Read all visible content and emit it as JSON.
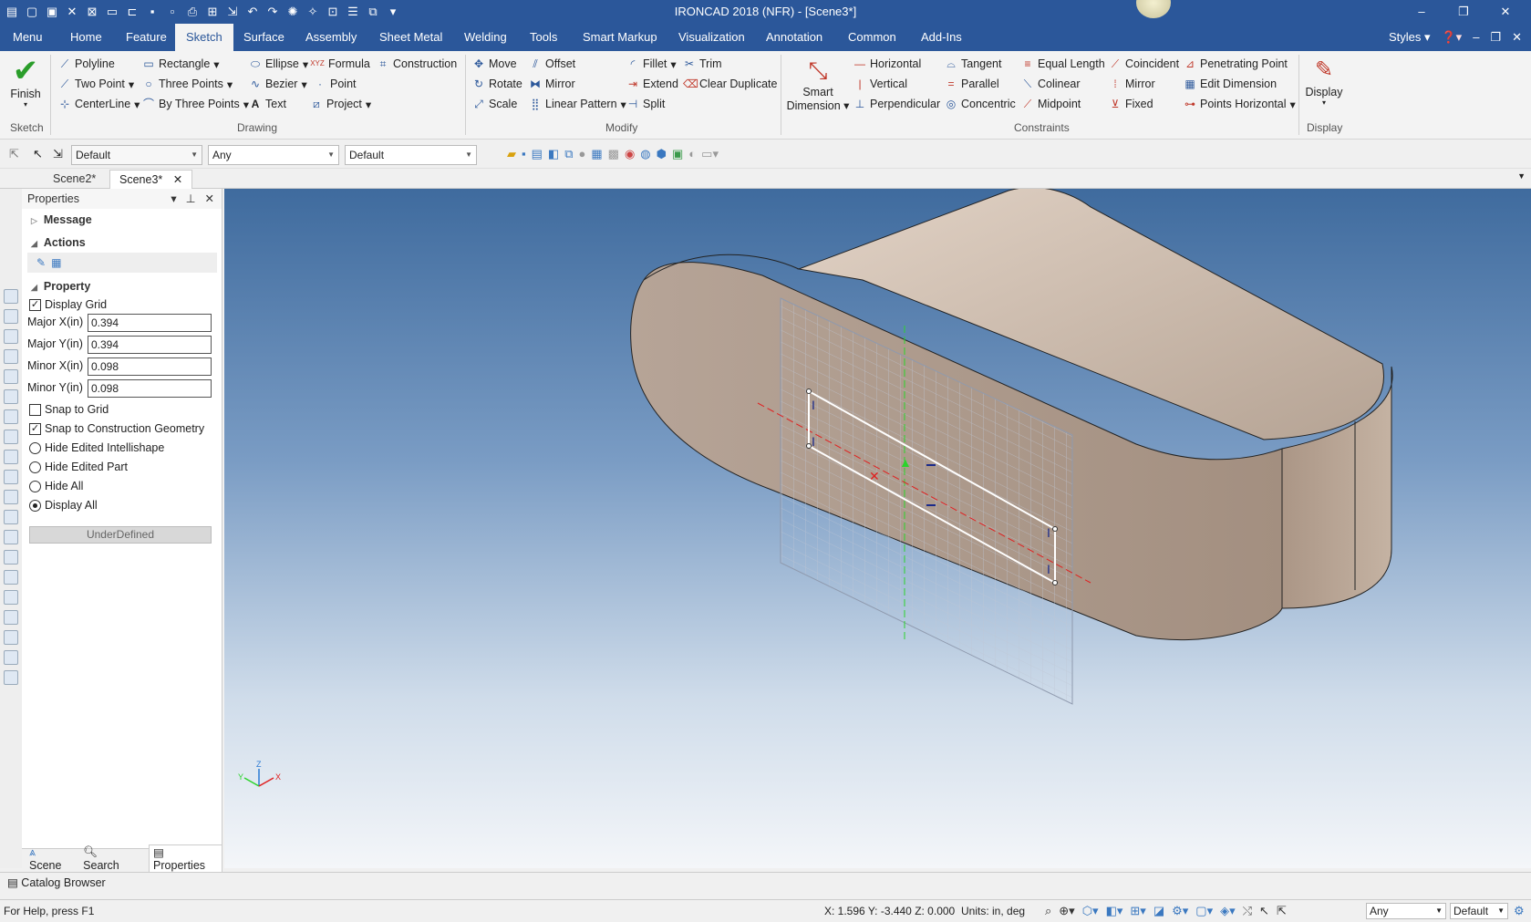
{
  "app": {
    "title": "IRONCAD 2018 (NFR) - [Scene3*]"
  },
  "menubar": {
    "tabs": [
      "Menu",
      "Home",
      "Feature",
      "Sketch",
      "Surface",
      "Assembly",
      "Sheet Metal",
      "Welding",
      "Tools",
      "Smart Markup",
      "Visualization",
      "Annotation",
      "Common",
      "Add-Ins"
    ],
    "active": "Sketch",
    "styles": "Styles"
  },
  "ribbon": {
    "sketch": {
      "finish": "Finish",
      "group": "Sketch"
    },
    "drawing": {
      "group": "Drawing",
      "polyline": "Polyline",
      "rectangle": "Rectangle",
      "ellipse": "Ellipse",
      "formula": "Formula",
      "construction": "Construction",
      "two_point": "Two Point",
      "three_points": "Three Points",
      "bezier": "Bezier",
      "point": "Point",
      "centerline": "CenterLine",
      "by_three_points": "By Three Points",
      "text": "Text",
      "project": "Project",
      "formula_glyph": "XYZ"
    },
    "modify": {
      "group": "Modify",
      "move": "Move",
      "offset": "Offset",
      "fillet": "Fillet",
      "trim": "Trim",
      "rotate": "Rotate",
      "mirror": "Mirror",
      "extend": "Extend",
      "clear_duplicate": "Clear Duplicate",
      "scale": "Scale",
      "linear_pattern": "Linear Pattern",
      "split": "Split"
    },
    "constraints": {
      "group": "Constraints",
      "smart_dimension": [
        "Smart",
        "Dimension"
      ],
      "horizontal": "Horizontal",
      "tangent": "Tangent",
      "equal_length": "Equal Length",
      "coincident": "Coincident",
      "penetrating_point": "Penetrating Point",
      "vertical": "Vertical",
      "parallel": "Parallel",
      "colinear": "Colinear",
      "mirror": "Mirror",
      "edit_dimension": "Edit Dimension",
      "perpendicular": "Perpendicular",
      "concentric": "Concentric",
      "midpoint": "Midpoint",
      "fixed": "Fixed",
      "points_horizontal": "Points Horizontal"
    },
    "display": {
      "label": "Display",
      "group": "Display"
    }
  },
  "toolbar": {
    "combo1": "Default",
    "combo2": "Any",
    "combo3": "Default"
  },
  "doctabs": [
    "Scene2*",
    "Scene3*"
  ],
  "properties": {
    "title": "Properties",
    "message": "Message",
    "actions": "Actions",
    "property": "Property",
    "display_grid": "Display Grid",
    "fields": [
      {
        "label": "Major X(in)",
        "value": "0.394"
      },
      {
        "label": "Major Y(in)",
        "value": "0.394"
      },
      {
        "label": "Minor X(in)",
        "value": "0.098"
      },
      {
        "label": "Minor Y(in)",
        "value": "0.098"
      }
    ],
    "snap_to_grid": "Snap to Grid",
    "snap_construction": "Snap to Construction Geometry",
    "hide_intellishape": "Hide Edited Intellishape",
    "hide_part": "Hide Edited Part",
    "hide_all": "Hide All",
    "display_all": "Display All",
    "status": "UnderDefined"
  },
  "bottom_tabs": {
    "scene": "Scene",
    "search": "Search",
    "properties": "Properties"
  },
  "catalog": "Catalog Browser",
  "status": {
    "help": "For Help, press F1",
    "coords": "X: 1.596 Y: -3.440 Z: 0.000",
    "units": "Units: in, deg",
    "filter": "Any",
    "style": "Default"
  },
  "triad": {
    "x": "X",
    "y": "Y",
    "z": "Z"
  }
}
